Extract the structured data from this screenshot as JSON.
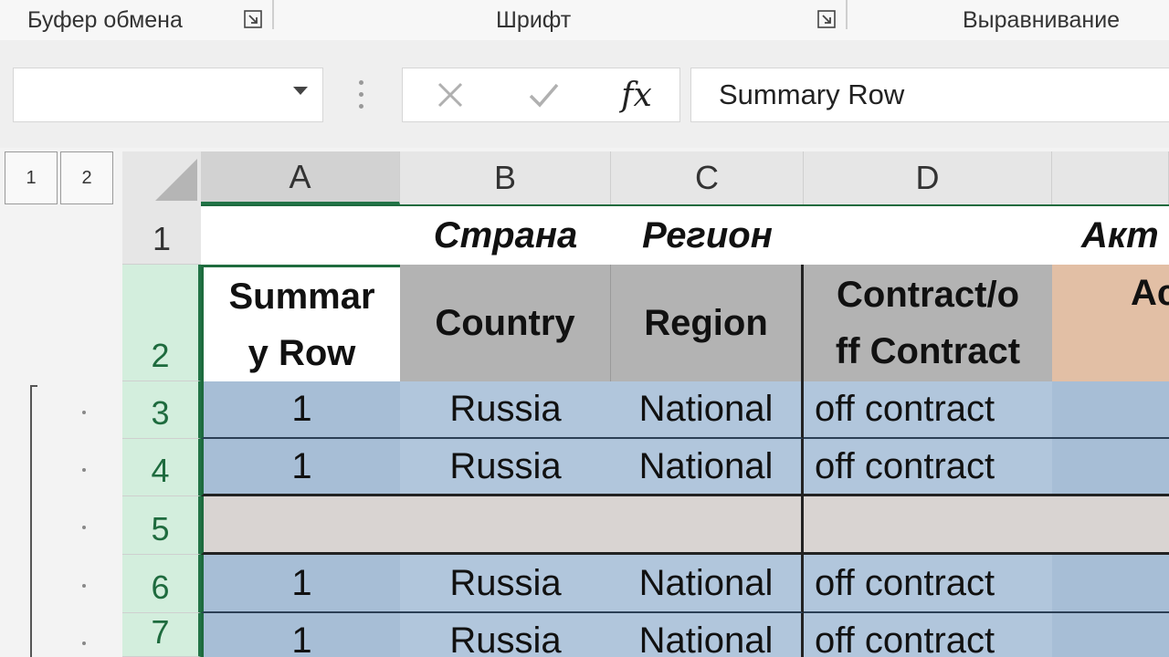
{
  "ribbon": {
    "clipboard_label": "Буфер обмена",
    "font_label": "Шрифт",
    "alignment_label": "Выравнивание"
  },
  "formula_bar": {
    "name_box_value": "",
    "fx_label": "fx",
    "formula_value": "Summary Row"
  },
  "outline": {
    "levels": [
      "1",
      "2"
    ]
  },
  "grid": {
    "columns": [
      "A",
      "B",
      "C",
      "D"
    ],
    "rows": [
      "1",
      "2",
      "3",
      "4",
      "5",
      "6",
      "7"
    ],
    "row1": {
      "b": "Страна",
      "c": "Регион",
      "e": "Акт"
    },
    "headers": {
      "a_line1": "Summar",
      "a_line2": "y Row",
      "b": "Country",
      "c": "Region",
      "d_line1": "Contract/o",
      "d_line2": "ff Contract",
      "e": "Ac"
    },
    "data": [
      {
        "row": "3",
        "a": "1",
        "b": "Russia",
        "c": "National",
        "d": "off contract"
      },
      {
        "row": "4",
        "a": "1",
        "b": "Russia",
        "c": "National",
        "d": "off contract"
      },
      {
        "row": "5",
        "a": "",
        "b": "",
        "c": "",
        "d": ""
      },
      {
        "row": "6",
        "a": "1",
        "b": "Russia",
        "c": "National",
        "d": "off contract"
      },
      {
        "row": "7",
        "a": "1",
        "b": "Russia",
        "c": "National",
        "d": "off contract"
      }
    ]
  }
}
